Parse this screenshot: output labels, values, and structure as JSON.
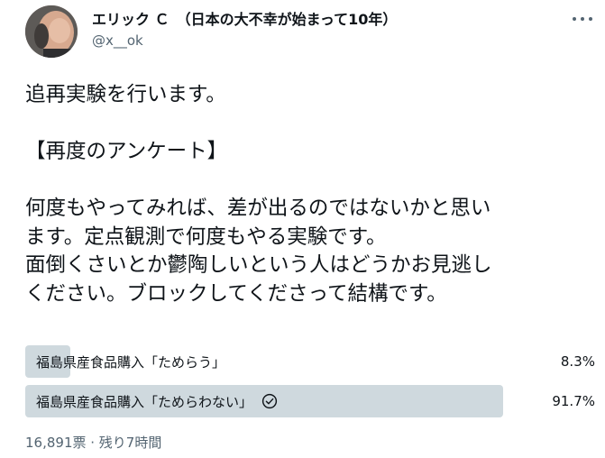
{
  "author": {
    "display_name": "エリック Ｃ　（日本の大不幸が始まって10年）",
    "handle": "@x__ok"
  },
  "tweet": {
    "lines": [
      "追再実験を行います。",
      "",
      "【再度のアンケート】",
      "",
      "何度もやってみれば、差が出るのではないかと思い",
      "ます。定点観測で何度もやる実験です。",
      "面倒くさいとか鬱陶しいという人はどうかお見逃し",
      "ください。ブロックしてくださって結構です。"
    ]
  },
  "poll": {
    "options": [
      {
        "label": "福島県産食品購入「ためらう」",
        "percent": "8.3%",
        "fraction": 0.083,
        "selected": false
      },
      {
        "label": "福島県産食品購入「ためらわない」",
        "percent": "91.7%",
        "fraction": 0.917,
        "selected": true
      }
    ],
    "meta": "16,891票 · 残り7時間"
  },
  "icons": {
    "more": "more-horizontal-icon",
    "check": "check-circle-icon"
  },
  "colors": {
    "bar": "#cfd9de",
    "text": "#0f1419",
    "secondary": "#536471"
  }
}
